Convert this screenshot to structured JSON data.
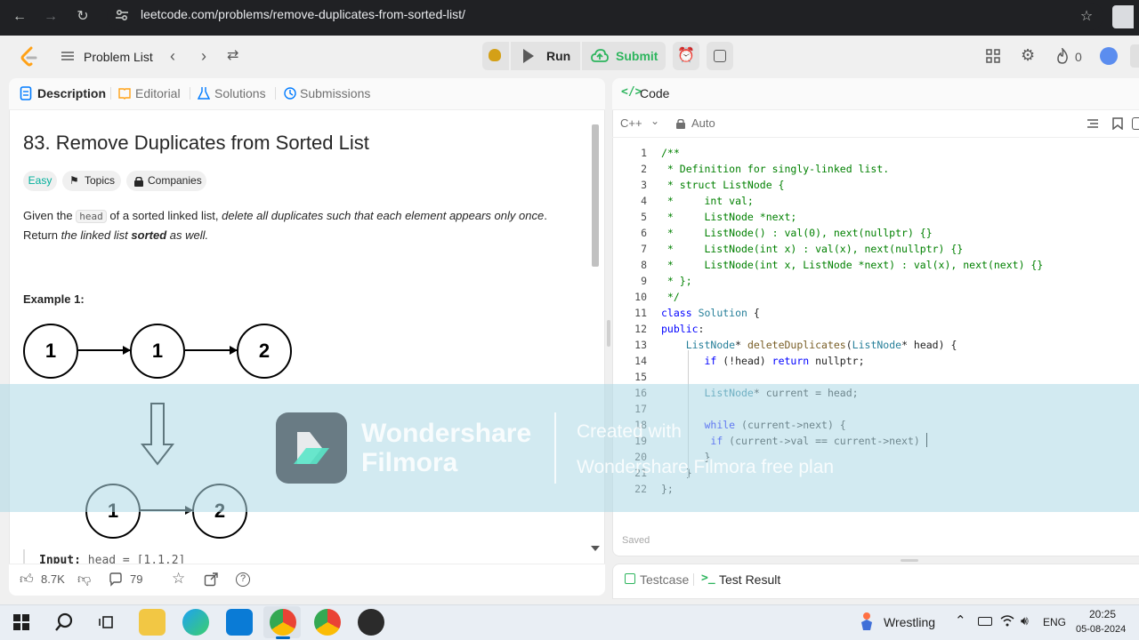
{
  "browser": {
    "url": "leetcode.com/problems/remove-duplicates-from-sorted-list/",
    "back_icon": "arrow-left-icon",
    "forward_icon": "arrow-right-icon",
    "reload_icon": "reload-icon"
  },
  "header": {
    "problem_list": "Problem List",
    "run": "Run",
    "submit": "Submit",
    "streak_count": "0",
    "accent_submit": "#2db55d"
  },
  "left_tabs": {
    "description": "Description",
    "editorial": "Editorial",
    "solutions": "Solutions",
    "submissions": "Submissions"
  },
  "problem": {
    "title": "83. Remove Duplicates from Sorted List",
    "difficulty": "Easy",
    "topics": "Topics",
    "companies": "Companies",
    "desc_1": "Given the ",
    "desc_code": "head",
    "desc_2": " of a sorted linked list, ",
    "desc_3": "delete all duplicates such that each element appears only once",
    "desc_4": ".",
    "desc_5": "Return ",
    "desc_6": "the linked list ",
    "desc_7": "sorted",
    "desc_8": " as well.",
    "example_label": "Example 1:",
    "list_before": [
      "1",
      "1",
      "2"
    ],
    "list_after": [
      "1",
      "2"
    ],
    "input_label": "Input:",
    "input_value": "head = [1,1,2]"
  },
  "footer_left": {
    "likes": "8.7K",
    "comments": "79"
  },
  "editor": {
    "title": "Code",
    "language": "C++",
    "mode": "Auto",
    "saved": "Saved",
    "line_numbers": [
      "1",
      "2",
      "3",
      "4",
      "5",
      "6",
      "7",
      "8",
      "9",
      "10",
      "11",
      "12",
      "13",
      "14",
      "15",
      "16",
      "17",
      "18",
      "19",
      "20",
      "21",
      "22"
    ]
  },
  "bottom_tabs": {
    "testcase": "Testcase",
    "test_result": "Test Result"
  },
  "watermark": {
    "brand_1": "Wondershare",
    "brand_2": "Filmora",
    "created": "Created with",
    "plan": "Wondershare Filmora free plan"
  },
  "taskbar": {
    "weather": "Wrestling",
    "lang": "ENG",
    "time": "20:25",
    "date": "05-08-2024"
  }
}
